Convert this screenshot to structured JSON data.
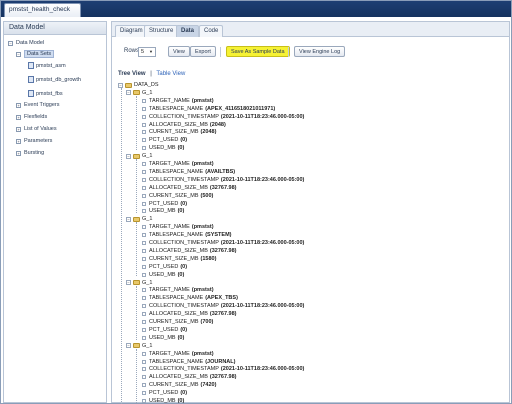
{
  "window": {
    "doc_tab": "pmstst_health_check"
  },
  "left_panel": {
    "title": "Data Model",
    "root": "Data Model",
    "data_sets_label": "Data Sets",
    "data_sets": [
      "pmstst_asm",
      "pmstst_db_growth",
      "pmstst_fbs"
    ],
    "other_items": [
      "Event Triggers",
      "Flexfields",
      "List of Values",
      "Parameters",
      "Bursting"
    ]
  },
  "tabs": [
    "Diagram",
    "Structure",
    "Data",
    "Code"
  ],
  "active_tab": "Data",
  "toolbar": {
    "rows_label": "Rows",
    "rows_value": "5",
    "view_label": "View",
    "export_label": "Export",
    "save_sample_label": "Save As Sample Data",
    "engine_log_label": "View Engine Log"
  },
  "view_links": {
    "tree": "Tree View",
    "separator": "|",
    "table": "Table View"
  },
  "xml": {
    "root": "DATA_DS",
    "group_name": "G_1",
    "groups": [
      [
        {
          "tag": "TARGET_NAME",
          "value": "(pmstst)"
        },
        {
          "tag": "TABLESPACE_NAME",
          "value": "(APEX_4116518021011971)"
        },
        {
          "tag": "COLLECTION_TIMESTAMP",
          "value": "(2021-10-11T18:23:46.000-05:00)"
        },
        {
          "tag": "ALLOCATED_SIZE_MB",
          "value": "(2048)"
        },
        {
          "tag": "CURENT_SIZE_MB",
          "value": "(2048)"
        },
        {
          "tag": "PCT_USED",
          "value": "(0)"
        },
        {
          "tag": "USED_MB",
          "value": "(0)"
        }
      ],
      [
        {
          "tag": "TARGET_NAME",
          "value": "(pmstst)"
        },
        {
          "tag": "TABLESPACE_NAME",
          "value": "(AVAILTBS)"
        },
        {
          "tag": "COLLECTION_TIMESTAMP",
          "value": "(2021-10-11T18:23:46.000-05:00)"
        },
        {
          "tag": "ALLOCATED_SIZE_MB",
          "value": "(32767.98)"
        },
        {
          "tag": "CURENT_SIZE_MB",
          "value": "(500)"
        },
        {
          "tag": "PCT_USED",
          "value": "(0)"
        },
        {
          "tag": "USED_MB",
          "value": "(0)"
        }
      ],
      [
        {
          "tag": "TARGET_NAME",
          "value": "(pmstst)"
        },
        {
          "tag": "TABLESPACE_NAME",
          "value": "(SYSTEM)"
        },
        {
          "tag": "COLLECTION_TIMESTAMP",
          "value": "(2021-10-11T18:23:46.000-05:00)"
        },
        {
          "tag": "ALLOCATED_SIZE_MB",
          "value": "(32767.98)"
        },
        {
          "tag": "CURENT_SIZE_MB",
          "value": "(1580)"
        },
        {
          "tag": "PCT_USED",
          "value": "(0)"
        },
        {
          "tag": "USED_MB",
          "value": "(0)"
        }
      ],
      [
        {
          "tag": "TARGET_NAME",
          "value": "(pmstst)"
        },
        {
          "tag": "TABLESPACE_NAME",
          "value": "(APEX_TBS)"
        },
        {
          "tag": "COLLECTION_TIMESTAMP",
          "value": "(2021-10-11T18:23:46.000-05:00)"
        },
        {
          "tag": "ALLOCATED_SIZE_MB",
          "value": "(32767.98)"
        },
        {
          "tag": "CURENT_SIZE_MB",
          "value": "(700)"
        },
        {
          "tag": "PCT_USED",
          "value": "(0)"
        },
        {
          "tag": "USED_MB",
          "value": "(0)"
        }
      ],
      [
        {
          "tag": "TARGET_NAME",
          "value": "(pmstst)"
        },
        {
          "tag": "TABLESPACE_NAME",
          "value": "(JOURNAL)"
        },
        {
          "tag": "COLLECTION_TIMESTAMP",
          "value": "(2021-10-11T18:23:46.000-05:00)"
        },
        {
          "tag": "ALLOCATED_SIZE_MB",
          "value": "(32767.98)"
        },
        {
          "tag": "CURENT_SIZE_MB",
          "value": "(7420)"
        },
        {
          "tag": "PCT_USED",
          "value": "(0)"
        },
        {
          "tag": "USED_MB",
          "value": "(0)"
        }
      ]
    ]
  },
  "icons": [
    "minus-icon",
    "plus-icon",
    "data-set-icon",
    "folder-icon"
  ],
  "colors": {
    "header_bg": "#1e3f73",
    "highlight_button": "#f6f233",
    "link": "#2e63b8"
  }
}
